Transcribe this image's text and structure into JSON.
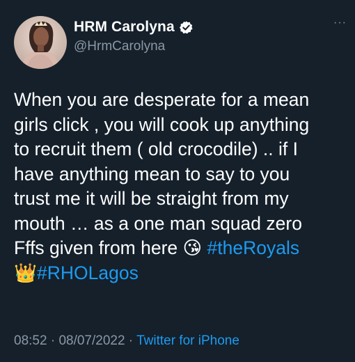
{
  "author": {
    "display_name": "HRM Carolyna",
    "handle": "@HrmCarolyna",
    "verified": true,
    "verified_icon": "verified-badge-icon"
  },
  "more_label": "···",
  "tweet": {
    "lines": [
      "When you are desperate for a mean",
      "girls click  , you will cook up anything",
      "to recruit them ( old crocodile) .. if I",
      "have anything mean to say to you",
      "trust me it will be straight from my",
      "mouth … as a one man squad zero"
    ],
    "line7_text": "Fffs given from here ",
    "line7_emoji": "😘",
    "hashtag1": "#theRoyals",
    "line8_emoji": "👑",
    "hashtag2": "#RHOLagos"
  },
  "meta": {
    "time": "08:52",
    "separator1": " · ",
    "date": "08/07/2022",
    "separator2": " · ",
    "source": "Twitter for iPhone"
  },
  "colors": {
    "background": "#15202b",
    "accent": "#1d9bf0",
    "secondary_text": "#8b98a5"
  }
}
